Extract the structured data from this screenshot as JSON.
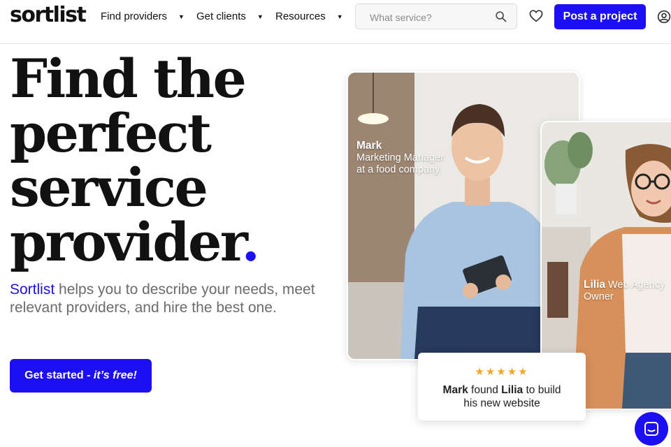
{
  "header": {
    "logo": "sortlist",
    "nav": [
      {
        "label": "Find providers"
      },
      {
        "label": "Get clients"
      },
      {
        "label": "Resources"
      }
    ],
    "search_placeholder": "What service?",
    "post_label": "Post a project"
  },
  "hero": {
    "headline_lines": [
      "Find the",
      "perfect",
      "service",
      "provider"
    ],
    "headline_dot": ".",
    "sub_brand": "Sortlist",
    "sub_rest": " helps you to describe your needs, meet relevant providers, and hire the best one.",
    "cta_main": "Get started - ",
    "cta_free": "it’s free!"
  },
  "cards": {
    "mark": {
      "name": "Mark",
      "role_line1": "Marketing Manager",
      "role_line2": "at a food company"
    },
    "lilia": {
      "name": "Lilia",
      "role_line1": " Web Agency",
      "role_line2": "Owner"
    }
  },
  "review": {
    "stars": "★★★★★",
    "rating": 5,
    "name1": "Mark",
    "mid": " found ",
    "name2": "Lilia",
    "end1": " to build",
    "end2": "his new website"
  },
  "colors": {
    "accent": "#1d0ff3",
    "stars": "#f5a623"
  },
  "icons": {
    "search": "search-icon",
    "favorites": "heart-icon",
    "account": "user-icon",
    "chat": "chat-icon"
  }
}
